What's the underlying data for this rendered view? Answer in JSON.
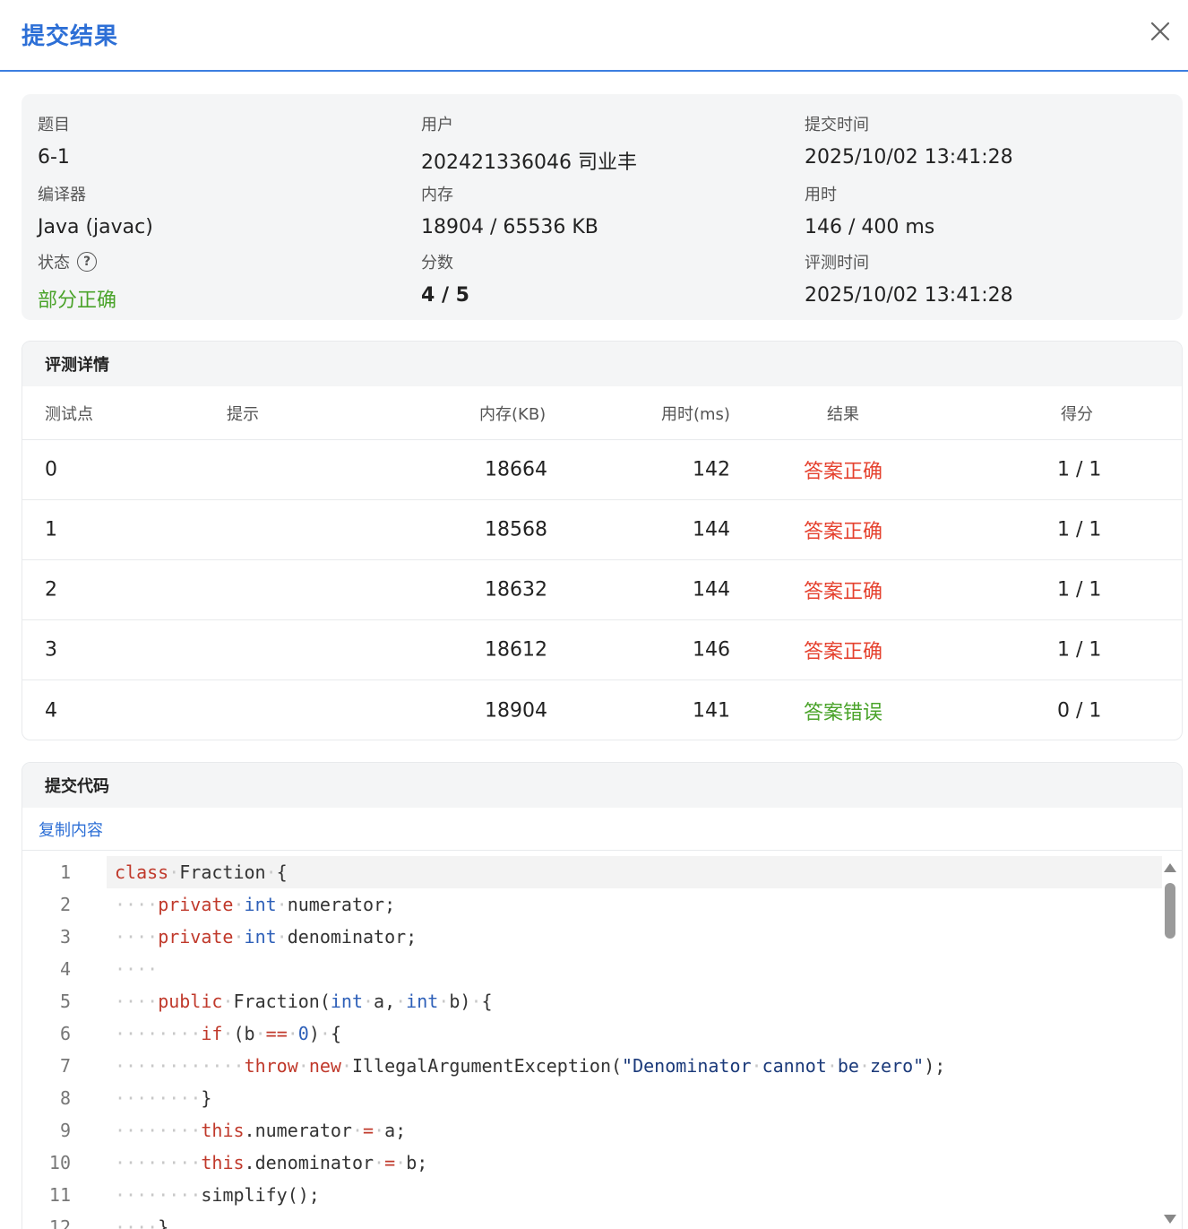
{
  "header": {
    "title": "提交结果"
  },
  "info": {
    "problem_label": "题目",
    "problem_value": "6-1",
    "user_label": "用户",
    "user_value": "202421336046 司业丰",
    "submit_time_label": "提交时间",
    "submit_time_value": "2025/10/02 13:41:28",
    "compiler_label": "编译器",
    "compiler_value": "Java (javac)",
    "memory_label": "内存",
    "memory_value": "18904 / 65536 KB",
    "time_label": "用时",
    "time_value": "146 / 400 ms",
    "status_label": "状态",
    "status_value": "部分正确",
    "score_label": "分数",
    "score_value": "4 / 5",
    "judge_time_label": "评测时间",
    "judge_time_value": "2025/10/02 13:41:28"
  },
  "details": {
    "title": "评测详情",
    "columns": [
      "测试点",
      "提示",
      "内存(KB)",
      "用时(ms)",
      "结果",
      "得分"
    ],
    "rows": [
      {
        "case": "0",
        "hint": "",
        "memory": "18664",
        "time": "142",
        "result": "答案正确",
        "score": "1 / 1"
      },
      {
        "case": "1",
        "hint": "",
        "memory": "18568",
        "time": "144",
        "result": "答案正确",
        "score": "1 / 1"
      },
      {
        "case": "2",
        "hint": "",
        "memory": "18632",
        "time": "144",
        "result": "答案正确",
        "score": "1 / 1"
      },
      {
        "case": "3",
        "hint": "",
        "memory": "18612",
        "time": "146",
        "result": "答案正确",
        "score": "1 / 1"
      },
      {
        "case": "4",
        "hint": "",
        "memory": "18904",
        "time": "141",
        "result": "答案错误",
        "score": "0 / 1"
      }
    ]
  },
  "code": {
    "title": "提交代码",
    "copy_label": "复制内容",
    "line_numbers": [
      "1",
      "2",
      "3",
      "4",
      "5",
      "6",
      "7",
      "8",
      "9",
      "10",
      "11",
      "12"
    ]
  },
  "colors": {
    "accent": "#2d6fd6",
    "correct": "#e5422f",
    "wrong": "#4aa32a",
    "partial": "#4aa32a"
  },
  "icons": {
    "close": "close-icon",
    "help": "help-circle-icon"
  }
}
